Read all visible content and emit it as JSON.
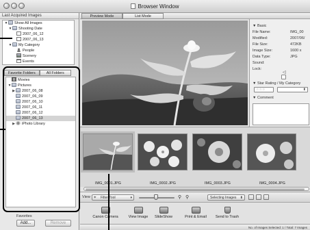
{
  "window": {
    "title": "Browser Window"
  },
  "sidebar": {
    "section_title": "Last Acquired Images",
    "top_tree": [
      {
        "label": "Show All Images",
        "level": 0,
        "expanded": true,
        "icon": "folder-icon"
      },
      {
        "label": "Shooting Date",
        "level": 1,
        "expanded": true,
        "icon": "folder-icon"
      },
      {
        "label": "2007_06_12",
        "level": 2,
        "expanded": null,
        "icon": "calendar-icon"
      },
      {
        "label": "2007_06_13",
        "level": 2,
        "expanded": null,
        "icon": "calendar-icon"
      },
      {
        "label": "My Category",
        "level": 1,
        "expanded": true,
        "icon": "folder-icon"
      },
      {
        "label": "People",
        "level": 2,
        "expanded": null,
        "icon": "people-icon"
      },
      {
        "label": "Scenery",
        "level": 2,
        "expanded": null,
        "icon": "scenery-icon"
      },
      {
        "label": "Events",
        "level": 2,
        "expanded": null,
        "icon": "events-icon"
      }
    ],
    "folder_tabs": [
      "Favorite Folders",
      "All Folders"
    ],
    "active_folder_tab": 0,
    "folder_tree": [
      {
        "label": "Movies",
        "level": 0,
        "expanded": null,
        "icon": "movies-icon",
        "selected": false
      },
      {
        "label": "Pictures",
        "level": 0,
        "expanded": true,
        "icon": "folder-icon",
        "selected": false
      },
      {
        "label": "2007_06_08",
        "level": 1,
        "expanded": false,
        "icon": "folder-icon",
        "selected": false
      },
      {
        "label": "2007_06_09",
        "level": 1,
        "expanded": null,
        "icon": "folder-icon",
        "selected": false
      },
      {
        "label": "2007_06_10",
        "level": 1,
        "expanded": null,
        "icon": "folder-icon",
        "selected": false
      },
      {
        "label": "2007_06_11",
        "level": 1,
        "expanded": null,
        "icon": "folder-icon",
        "selected": false
      },
      {
        "label": "2007_06_12",
        "level": 1,
        "expanded": null,
        "icon": "folder-icon",
        "selected": false
      },
      {
        "label": "2007_06_13",
        "level": 1,
        "expanded": null,
        "icon": "folder-icon",
        "selected": true
      },
      {
        "label": "iPhoto Library",
        "level": 1,
        "expanded": false,
        "icon": "iphoto-icon",
        "selected": false
      }
    ],
    "favorites_label": "Favorites",
    "add_button": "Add...",
    "remove_button": "Remove"
  },
  "modes": {
    "preview": "Preview Mode",
    "list": "List Mode",
    "active": "preview"
  },
  "info": {
    "basic_header": "Basic",
    "fields": [
      {
        "label": "File Name:",
        "value": "IMG_00"
      },
      {
        "label": "Modified:",
        "value": "2007/06/"
      },
      {
        "label": "File Size:",
        "value": "472KB"
      },
      {
        "label": "Image Size:",
        "value": "1600 x"
      },
      {
        "label": "Data Type:",
        "value": "JPG"
      },
      {
        "label": "Sound:",
        "value": ""
      },
      {
        "label": "Lock:",
        "value": ""
      }
    ],
    "rating_header": "Star Rating / My Category",
    "comment_header": "Comment"
  },
  "thumbnails": [
    {
      "label": "IMG_0001.JPG",
      "selected": true
    },
    {
      "label": "IMG_0002.JPG",
      "selected": false
    },
    {
      "label": "IMG_0003.JPG",
      "selected": false
    },
    {
      "label": "IMG_0004.JPG",
      "selected": false
    }
  ],
  "toolbar": {
    "view_label": "View",
    "filter_tool": "Filter Tool",
    "selecting_images": "Selecting Images"
  },
  "actions": [
    {
      "label": "Canon Camera",
      "icon": "camera-icon"
    },
    {
      "label": "View Image",
      "icon": "view-image-icon"
    },
    {
      "label": "SlideShow",
      "icon": "slideshow-icon"
    },
    {
      "label": "Print & Email",
      "icon": "printer-icon"
    },
    {
      "label": "Send to Trash",
      "icon": "trash-icon"
    }
  ],
  "status": {
    "text": "No. of Images Selected: 1 / Total: 7 Images"
  }
}
